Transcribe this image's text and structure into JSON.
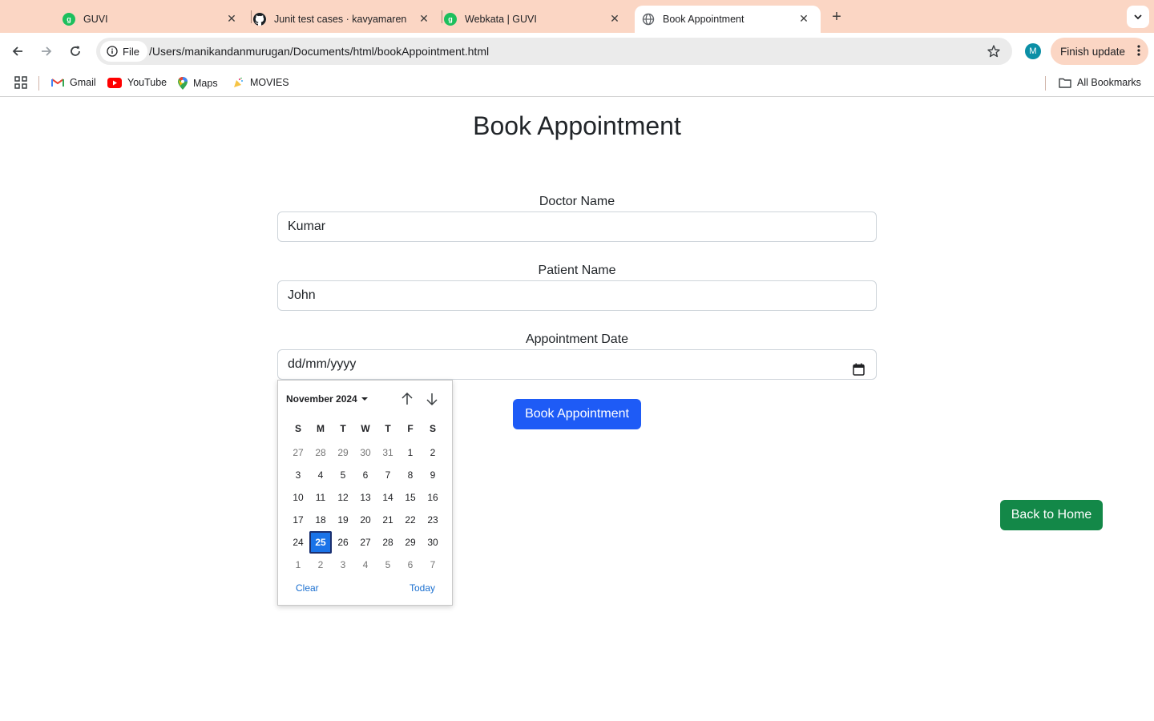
{
  "browser": {
    "tabs": [
      {
        "title": "GUVI",
        "favicon": "guvi-icon",
        "active": false
      },
      {
        "title": "Junit test cases · kavyamaren",
        "favicon": "github-icon",
        "active": false
      },
      {
        "title": "Webkata | GUVI",
        "favicon": "guvi-icon",
        "active": false
      },
      {
        "title": "Book Appointment",
        "favicon": "globe-icon",
        "active": true
      }
    ],
    "address": {
      "chip_label": "File",
      "url": "/Users/manikandanmurugan/Documents/html/bookAppointment.html"
    },
    "profile_initial": "M",
    "finish_update_label": "Finish update",
    "bookmarks": [
      {
        "label": "Gmail",
        "icon": "gmail-icon"
      },
      {
        "label": "YouTube",
        "icon": "youtube-icon"
      },
      {
        "label": "Maps",
        "icon": "maps-icon"
      },
      {
        "label": "MOVIES",
        "icon": "movies-icon"
      }
    ],
    "all_bookmarks_label": "All Bookmarks",
    "colors": {
      "tabstrip": "#fbd6c4",
      "omnibox": "#ebebeb"
    }
  },
  "page": {
    "title": "Book Appointment",
    "doctor": {
      "label": "Doctor Name",
      "value": "Kumar"
    },
    "patient": {
      "label": "Patient Name",
      "value": "John"
    },
    "date": {
      "label": "Appointment Date",
      "value": "dd/mm/yyyy"
    },
    "submit_label": "Book Appointment",
    "home_label": "Back to Home",
    "colors": {
      "primary": "#1e5bf6",
      "success": "#138848"
    }
  },
  "datepicker": {
    "month_label": "November 2024",
    "weekdays": [
      "S",
      "M",
      "T",
      "W",
      "T",
      "F",
      "S"
    ],
    "weeks": [
      [
        {
          "d": "27",
          "m": true
        },
        {
          "d": "28",
          "m": true
        },
        {
          "d": "29",
          "m": true
        },
        {
          "d": "30",
          "m": true
        },
        {
          "d": "31",
          "m": true
        },
        {
          "d": "1"
        },
        {
          "d": "2"
        }
      ],
      [
        {
          "d": "3"
        },
        {
          "d": "4"
        },
        {
          "d": "5"
        },
        {
          "d": "6"
        },
        {
          "d": "7"
        },
        {
          "d": "8"
        },
        {
          "d": "9"
        }
      ],
      [
        {
          "d": "10"
        },
        {
          "d": "11"
        },
        {
          "d": "12"
        },
        {
          "d": "13"
        },
        {
          "d": "14"
        },
        {
          "d": "15"
        },
        {
          "d": "16"
        }
      ],
      [
        {
          "d": "17"
        },
        {
          "d": "18"
        },
        {
          "d": "19"
        },
        {
          "d": "20"
        },
        {
          "d": "21"
        },
        {
          "d": "22"
        },
        {
          "d": "23"
        }
      ],
      [
        {
          "d": "24"
        },
        {
          "d": "25",
          "sel": true
        },
        {
          "d": "26"
        },
        {
          "d": "27"
        },
        {
          "d": "28"
        },
        {
          "d": "29"
        },
        {
          "d": "30"
        }
      ],
      [
        {
          "d": "1",
          "m": true
        },
        {
          "d": "2",
          "m": true
        },
        {
          "d": "3",
          "m": true
        },
        {
          "d": "4",
          "m": true
        },
        {
          "d": "5",
          "m": true
        },
        {
          "d": "6",
          "m": true
        },
        {
          "d": "7",
          "m": true
        }
      ]
    ],
    "clear_label": "Clear",
    "today_label": "Today"
  }
}
